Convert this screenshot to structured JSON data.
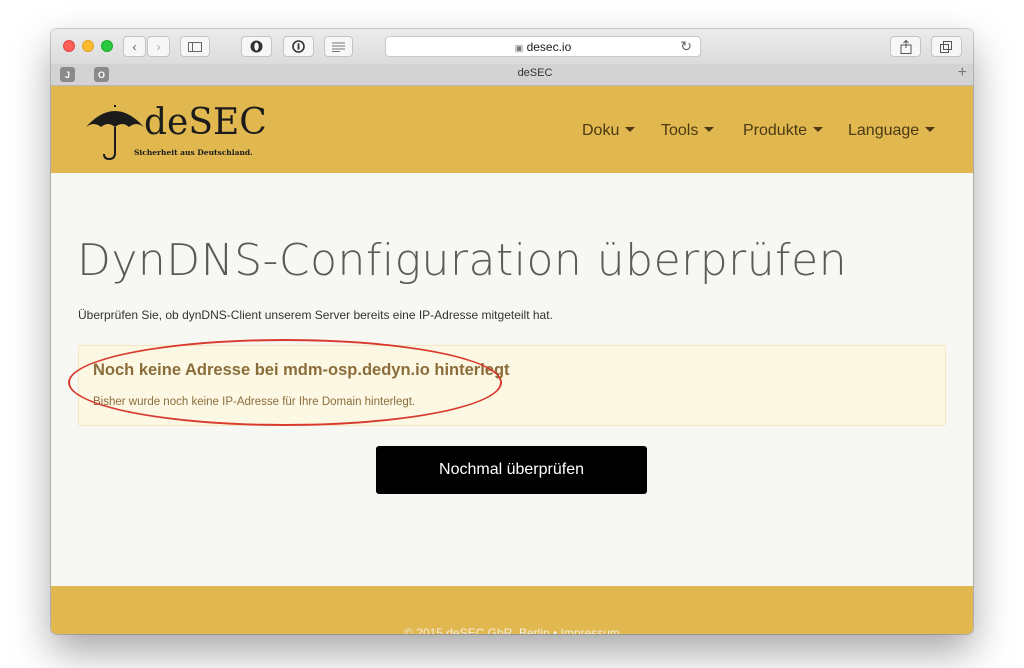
{
  "browser": {
    "url": "desec.io",
    "tab_title": "deSEC",
    "pinned_tabs": [
      "J",
      "O"
    ],
    "new_tab_symbol": "+"
  },
  "site": {
    "logo": {
      "name": "deSEC",
      "tagline": "Sicherheit aus Deutschland."
    },
    "nav": [
      {
        "label": "Doku"
      },
      {
        "label": "Tools"
      },
      {
        "label": "Produkte"
      },
      {
        "label": "Language"
      }
    ],
    "page_title": "DynDNS-Configuration überprüfen",
    "lead": "Überprüfen Sie, ob dynDNS-Client unserem Server bereits eine IP-Adresse mitgeteilt hat.",
    "alert": {
      "title": "Noch keine Adresse bei mdm-osp.dedyn.io hinterlegt",
      "text": "Bisher wurde noch keine IP-Adresse für Ihre Domain hinterlegt."
    },
    "button_label": "Nochmal überprüfen",
    "footer": "© 2015 deSEC GbR, Berlin • Impressum"
  },
  "colors": {
    "brand": "#e1b74f",
    "alert_bg": "#fcf8e3",
    "alert_text": "#8a6d3b",
    "highlight_circle": "#d83a2e"
  }
}
